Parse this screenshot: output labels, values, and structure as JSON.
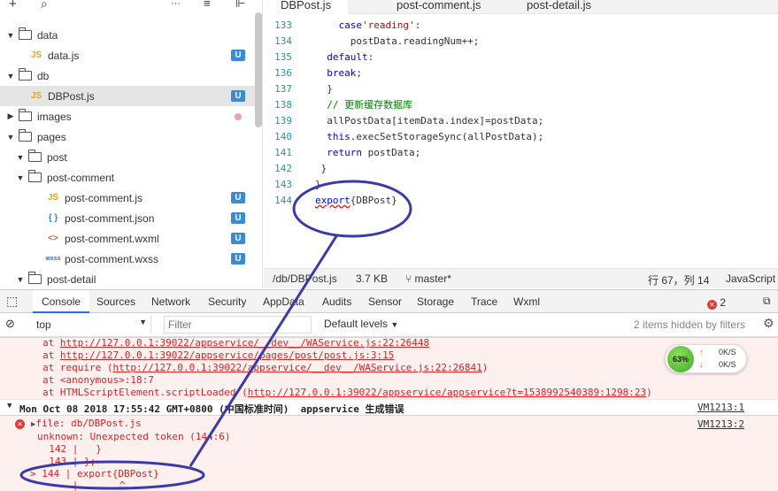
{
  "explorer": {
    "toolbar": {
      "add": "+",
      "search": "⌕",
      "more": "···",
      "collapse": "≡",
      "split": "⊩"
    },
    "rows": [
      {
        "label": "data",
        "kind": "folder",
        "depth": 0,
        "badge": ""
      },
      {
        "label": "data.js",
        "kind": "js",
        "depth": 1,
        "badge": "U"
      },
      {
        "label": "db",
        "kind": "folder",
        "depth": 0,
        "badge": ""
      },
      {
        "label": "DBPost.js",
        "kind": "js",
        "depth": 1,
        "badge": "U",
        "selected": true
      },
      {
        "label": "images",
        "kind": "folder-collapsed",
        "depth": 0,
        "badge": "dot"
      },
      {
        "label": "pages",
        "kind": "folder",
        "depth": 0,
        "badge": ""
      },
      {
        "label": "post",
        "kind": "folder",
        "depth": 1,
        "badge": ""
      },
      {
        "label": "post-comment",
        "kind": "folder",
        "depth": 2,
        "badge": ""
      },
      {
        "label": "post-comment.js",
        "kind": "js",
        "depth": 3,
        "badge": "U"
      },
      {
        "label": "post-comment.json",
        "kind": "json",
        "depth": 3,
        "badge": "U"
      },
      {
        "label": "post-comment.wxml",
        "kind": "wxml",
        "depth": 3,
        "badge": "U"
      },
      {
        "label": "post-comment.wxss",
        "kind": "wxss",
        "depth": 3,
        "badge": "U"
      },
      {
        "label": "post-detail",
        "kind": "folder",
        "depth": 2,
        "badge": ""
      }
    ],
    "icons": {
      "js": "JS",
      "json": "{ }",
      "wxml": "<>",
      "wxss": "wxss"
    }
  },
  "editor": {
    "tabs": [
      "DBPost.js",
      "post-comment.js",
      "post-detail.js"
    ],
    "lines": [
      {
        "n": "133",
        "t": "    case'reading':"
      },
      {
        "n": "134",
        "t": "      postData.readingNum++;"
      },
      {
        "n": "135",
        "t": "  default:"
      },
      {
        "n": "136",
        "t": "  break;"
      },
      {
        "n": "137",
        "t": "  }"
      },
      {
        "n": "138",
        "t": "  // 更新缓存数据库"
      },
      {
        "n": "139",
        "t": "  allPostData[itemData.index]=postData;"
      },
      {
        "n": "140",
        "t": "  this.execSetStorageSync(allPostData);"
      },
      {
        "n": "141",
        "t": "  return postData;"
      },
      {
        "n": "142",
        "t": " }"
      },
      {
        "n": "143",
        "t": "}"
      },
      {
        "n": "144",
        "t": "export{DBPost}"
      }
    ],
    "status": {
      "path": "/db/DBPost.js",
      "size": "3.7 KB",
      "branch": "master*",
      "position": "行 67，列 14",
      "language": "JavaScript"
    }
  },
  "devtools": {
    "tabs": [
      "Console",
      "Sources",
      "Network",
      "Security",
      "AppData",
      "Audits",
      "Sensor",
      "Storage",
      "Trace",
      "Wxml"
    ],
    "error_count": "2",
    "context": "top",
    "filter_placeholder": "Filter",
    "levels": "Default levels",
    "hidden_info": "2 items hidden by filters",
    "stack": [
      {
        "pre": "at ",
        "link": "http://127.0.0.1:39022/appservice/__dev__/WAService.js:22:26448",
        "post": ""
      },
      {
        "pre": "at ",
        "link": "http://127.0.0.1:39022/appservice/pages/post/post.js:3:15",
        "post": ""
      },
      {
        "pre": "at require (",
        "link": "http://127.0.0.1:39022/appservice/__dev__/WAService.js:22:26841",
        "post": ")"
      },
      {
        "pre": "at <anonymous>:18:7",
        "link": "",
        "post": ""
      },
      {
        "pre": "at HTMLScriptElement.scriptLoaded (",
        "link": "http://127.0.0.1:39022/appservice/appservice?t=1538992540389:1298:23",
        "post": ")"
      }
    ],
    "group_header": "Mon Oct 08 2018 17:55:42 GMT+0800 (中国标准时间)  appservice 生成错误",
    "group_vm": "VM1213:1",
    "error": {
      "file": "file: db/DBPost.js",
      "vm": "VM1213:2",
      "msg": "unknown: Unexpected token (144:6)",
      "l142": "  142 |   }",
      "l143": "  143 | };",
      "l144": "> 144 | export{DBPost}",
      "caret": "      |       ^"
    }
  },
  "network_widget": {
    "percent": "63%",
    "up": "0K/S",
    "down": "0K/S",
    "up_arrow": "↑",
    "down_arrow": "↓"
  },
  "colors": {
    "annotation": "#3a3aa8",
    "error": "#d22222",
    "badge": "#3a8bd1"
  }
}
